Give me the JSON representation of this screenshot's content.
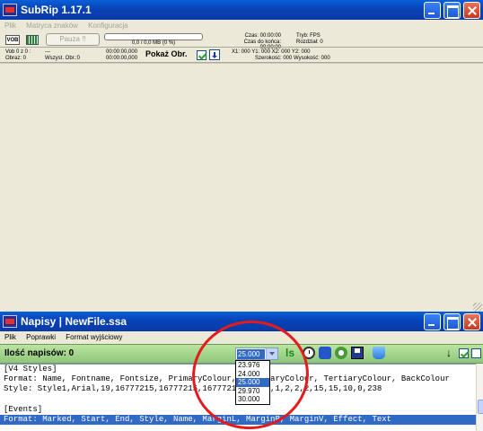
{
  "main_window": {
    "title": "SubRip 1.17.1",
    "menu": [
      "Plik",
      "Matryca znaków",
      "Konfiguracja"
    ],
    "toolbar": {
      "vob_icon_text": "VOB",
      "pause_label": "Pauza !!",
      "progress_text": "0,0 / 0,0 MB (0 %)",
      "czas_label": "Czas: 00:00:00",
      "czas_do_konca_label": "Czas do końca: 00:00:00",
      "tryb_label": "Tryb: FPS",
      "rozdzial_label": "Rozdział: 0"
    },
    "row2": {
      "vob_line": "Vob 0  z  0 :",
      "vob_dash": "---",
      "obraz_line": "Obraz:      0",
      "wszyst_line": "Wszyst. Obr.:0",
      "time1": "00:00:00,000",
      "time2": "00:00:00,000",
      "pokaz_label": "Pokaż Obr.",
      "coords_line1": "X1: 000  Y1: 000  X2: 000  Y2: 000",
      "coords_line2": "Szerokość: 000    Wysokość: 000"
    }
  },
  "sub_window": {
    "title": "Napisy | NewFile.ssa",
    "menu": [
      "Plik",
      "Poprawki",
      "Format wyjściowy"
    ],
    "count_label": "Ilość napisów:  0",
    "fps_selected": "25.000",
    "fps_options": [
      "23.976",
      "24.000",
      "25.000",
      "29.970",
      "30.000"
    ],
    "ls_icon_text": "ls",
    "arrow_down": "↓",
    "lines": [
      "[V4 Styles]",
      "Format: Name, Fontname, Fontsize, PrimaryColour, SecondaryColour, TertiaryColour, BackColour",
      "Style: Style1,Arial,19,16777215,16777215,16777215,0,0,0,1,2,2,2,15,15,10,0,238",
      "",
      "[Events]",
      "Format: Marked, Start, End, Style, Name, MarginL, MarginR, MarginV, Effect, Text"
    ]
  },
  "colors": {
    "titlebar": "#0842b5",
    "toolbar_green": "#8fc77a",
    "selection": "#316ac5",
    "annotation": "#e41b1b"
  }
}
